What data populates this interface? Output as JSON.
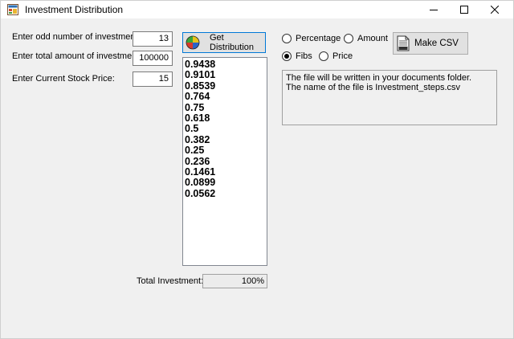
{
  "window": {
    "title": "Investment Distribution",
    "controls": {
      "minimize": "minimize",
      "maximize": "maximize",
      "close": "close"
    }
  },
  "inputs": {
    "odd_investments": {
      "label": "Enter odd number of investments:",
      "value": "13"
    },
    "total_amount": {
      "label": "Enter total amount of investment:",
      "value": "100000"
    },
    "stock_price": {
      "label": "Enter Current Stock Price:",
      "value": "15"
    }
  },
  "buttons": {
    "get_distribution": "Get Distribution",
    "make_csv": "Make CSV"
  },
  "distribution_list": [
    "0.9438",
    "0.9101",
    "0.8539",
    "0.764",
    "0.75",
    "0.618",
    "0.5",
    "0.382",
    "0.25",
    "0.236",
    "0.1461",
    "0.0899",
    "0.0562"
  ],
  "radios": [
    {
      "label": "Percentage",
      "checked": false
    },
    {
      "label": "Amount",
      "checked": false
    },
    {
      "label": "Fibs",
      "checked": true
    },
    {
      "label": "Price",
      "checked": false
    }
  ],
  "info": {
    "line1": "The file will be written in your documents folder.",
    "line2": "The name of the file is Investment_steps.csv"
  },
  "total": {
    "label": "Total Investment:",
    "value": "100%"
  },
  "icons": {
    "app": "app-window-icon",
    "distribution": "pie-chart-icon",
    "csv": "csv-file-icon"
  }
}
